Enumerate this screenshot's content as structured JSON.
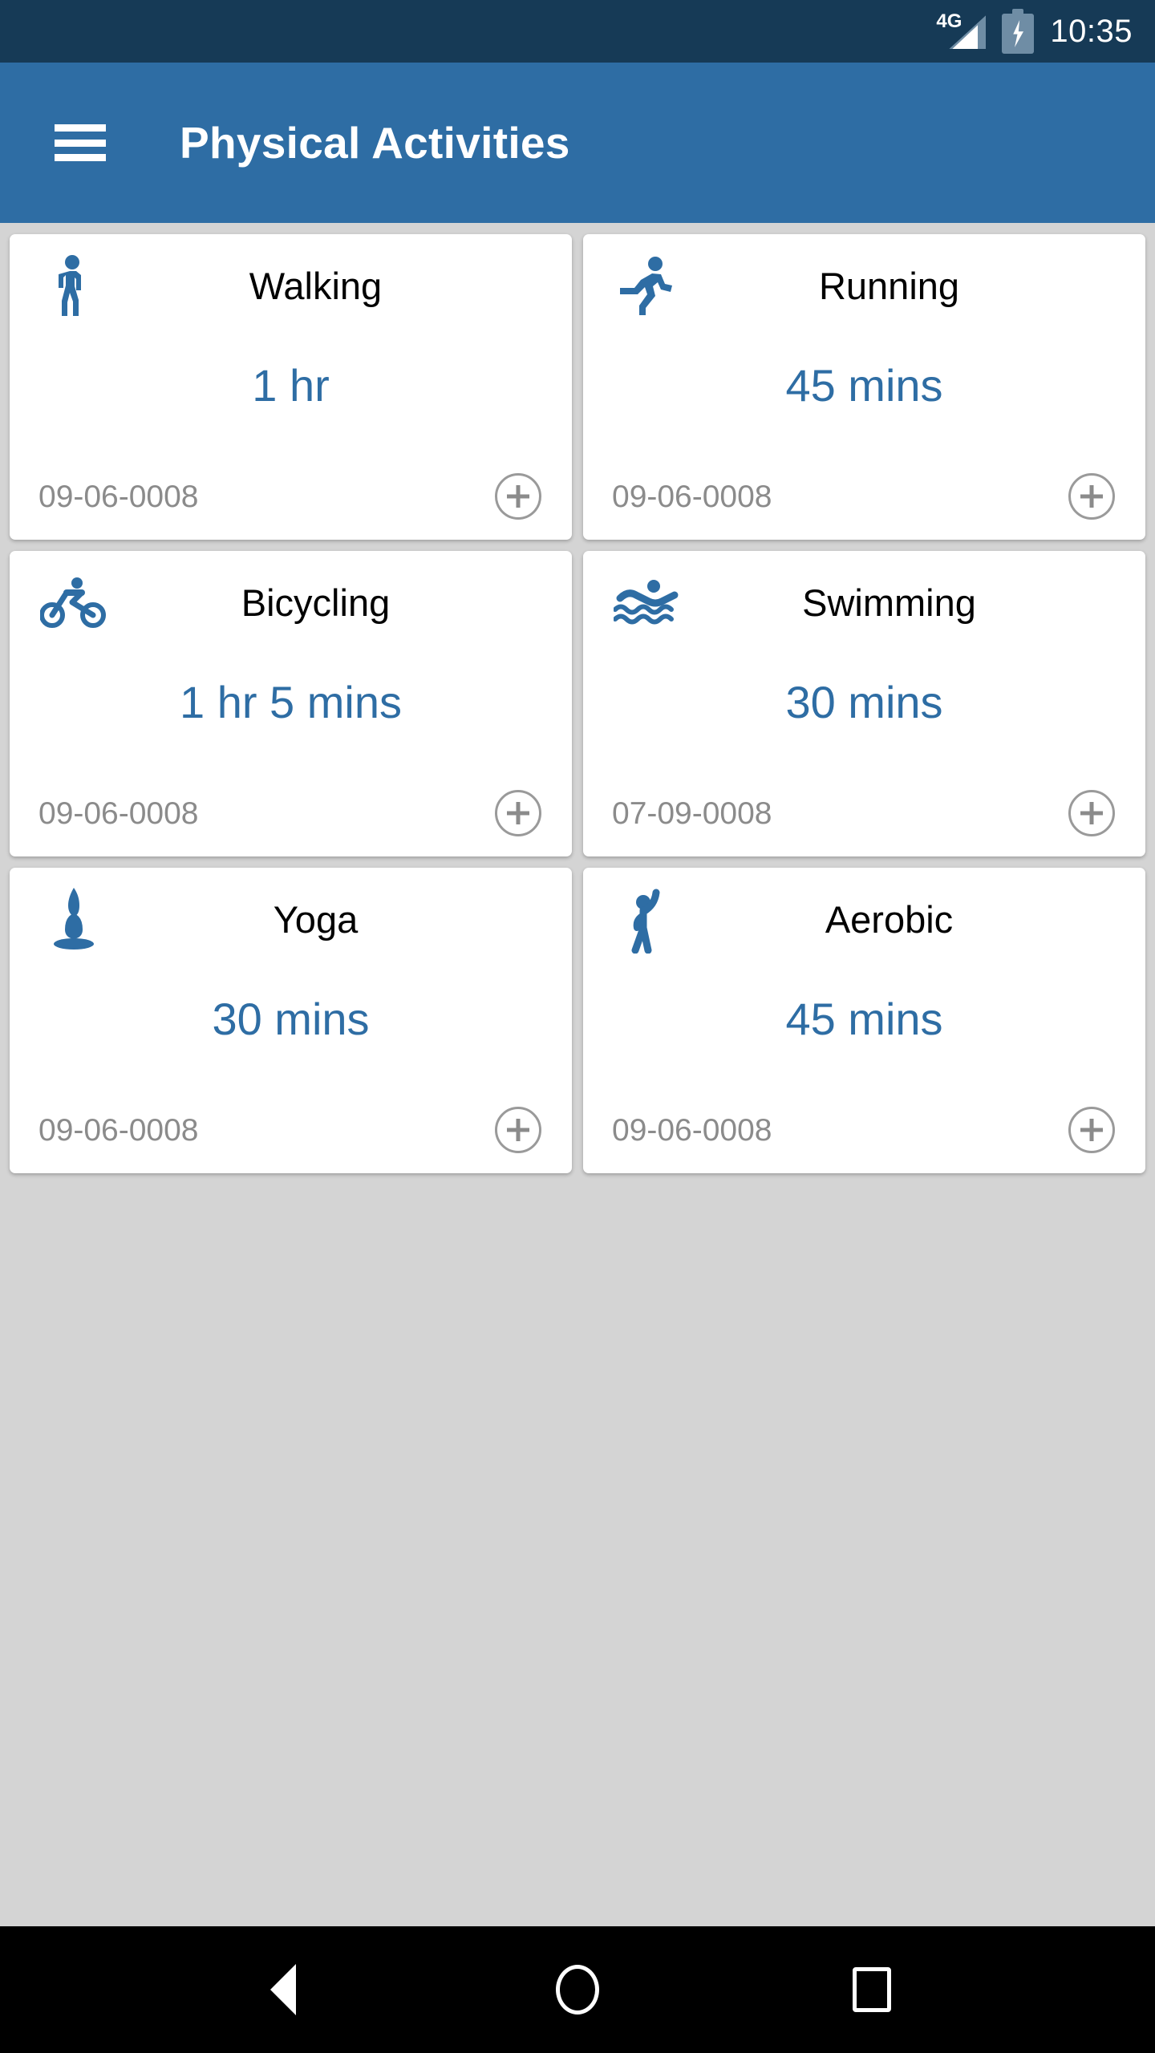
{
  "status_bar": {
    "network_label": "4G",
    "time": "10:35",
    "battery_state": "charging",
    "background_color": "#163a56"
  },
  "app_bar": {
    "title": "Physical Activities",
    "menu_icon": "hamburger-menu-icon",
    "background_color": "#2e6da4"
  },
  "theme": {
    "accent_color": "#2e6da4",
    "page_background": "#d4d4d4",
    "card_background": "#ffffff",
    "muted_text_color": "#8b8b8b"
  },
  "activities": [
    {
      "icon": "walking-icon",
      "name": "Walking",
      "duration": "1 hr",
      "date": "09-06-0008",
      "add_label": "+"
    },
    {
      "icon": "running-icon",
      "name": "Running",
      "duration": "45 mins",
      "date": "09-06-0008",
      "add_label": "+"
    },
    {
      "icon": "bicycling-icon",
      "name": "Bicycling",
      "duration": "1 hr 5 mins",
      "date": "09-06-0008",
      "add_label": "+"
    },
    {
      "icon": "swimming-icon",
      "name": "Swimming",
      "duration": "30 mins",
      "date": "07-09-0008",
      "add_label": "+"
    },
    {
      "icon": "yoga-icon",
      "name": "Yoga",
      "duration": "30 mins",
      "date": "09-06-0008",
      "add_label": "+"
    },
    {
      "icon": "aerobic-icon",
      "name": "Aerobic",
      "duration": "45 mins",
      "date": "09-06-0008",
      "add_label": "+"
    }
  ],
  "nav_bar": {
    "back_label": "Back",
    "home_label": "Home",
    "recents_label": "Recents",
    "background_color": "#000000"
  }
}
